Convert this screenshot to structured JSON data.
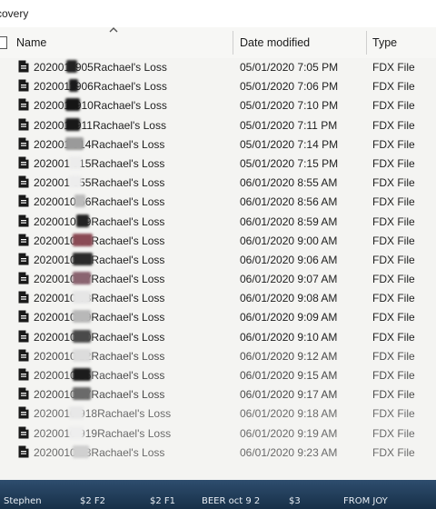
{
  "breadcrumb": "covery",
  "header": {
    "name": "Name",
    "date": "Date modified",
    "type": "Type"
  },
  "icons": {
    "file": "document-icon",
    "sort": "chevron-up-icon"
  },
  "files": [
    {
      "name": "2020011905Rachael's Loss",
      "date": "05/01/2020 7:05 PM",
      "type": "FDX File"
    },
    {
      "name": "2020011906Rachael's Loss",
      "date": "05/01/2020 7:06 PM",
      "type": "FDX File"
    },
    {
      "name": "2020011910Rachael's Loss",
      "date": "05/01/2020 7:10 PM",
      "type": "FDX File"
    },
    {
      "name": "2020011911Rachael's Loss",
      "date": "05/01/2020 7:11 PM",
      "type": "FDX File"
    },
    {
      "name": "202001 914Rachael's Loss",
      "date": "05/01/2020 7:14 PM",
      "type": "FDX File"
    },
    {
      "name": "202001 915Rachael's Loss",
      "date": "05/01/2020 7:15 PM",
      "type": "FDX File"
    },
    {
      "name": "202001 855Rachael's Loss",
      "date": "06/01/2020 8:55 AM",
      "type": "FDX File"
    },
    {
      "name": "2020010 56Rachael's Loss",
      "date": "06/01/2020 8:56 AM",
      "type": "FDX File"
    },
    {
      "name": "2020010 59Rachael's Loss",
      "date": "06/01/2020 8:59 AM",
      "type": "FDX File"
    },
    {
      "name": "2020010 00Rachael's Loss",
      "date": "06/01/2020 9:00 AM",
      "type": "FDX File"
    },
    {
      "name": "2020010 06Rachael's Loss",
      "date": "06/01/2020 9:06 AM",
      "type": "FDX File"
    },
    {
      "name": "2020010 07Rachael's Loss",
      "date": "06/01/2020 9:07 AM",
      "type": "FDX File"
    },
    {
      "name": "2020010 08Rachael's Loss",
      "date": "06/01/2020 9:08 AM",
      "type": "FDX File"
    },
    {
      "name": "2020010 09Rachael's Loss",
      "date": "06/01/2020 9:09 AM",
      "type": "FDX File"
    },
    {
      "name": "2020010 10Rachael's Loss",
      "date": "06/01/2020 9:10 AM",
      "type": "FDX File"
    },
    {
      "name": "2020010 12Rachael's Loss",
      "date": "06/01/2020 9:12 AM",
      "type": "FDX File"
    },
    {
      "name": "2020010 15Rachael's Loss",
      "date": "06/01/2020 9:15 AM",
      "type": "FDX File"
    },
    {
      "name": "2020010 17Rachael's Loss",
      "date": "06/01/2020 9:17 AM",
      "type": "FDX File"
    },
    {
      "name": "2020010 918Rachael's Loss",
      "date": "06/01/2020 9:18 AM",
      "type": "FDX File"
    },
    {
      "name": "2020010 919Rachael's Loss",
      "date": "06/01/2020 9:19 AM",
      "type": "FDX File"
    },
    {
      "name": "2020010 23Rachael's Loss",
      "date": "06/01/2020 9:23 AM",
      "type": "FDX File"
    }
  ],
  "taskbar": [
    "Stephen",
    "$2 F2",
    "$2 F1",
    "BEER oct 9 2",
    "$3",
    "FROM JOY"
  ]
}
